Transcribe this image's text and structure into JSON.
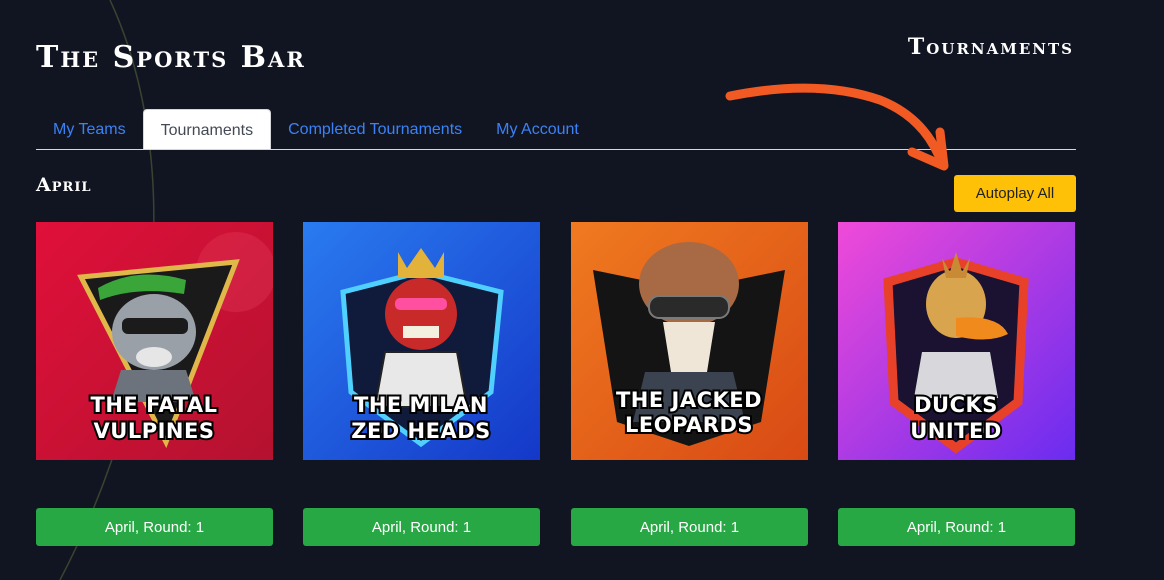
{
  "header": {
    "brand": "The Sports Bar",
    "page_title": "Tournaments"
  },
  "tabs": [
    {
      "label": "My Teams",
      "active": false
    },
    {
      "label": "Tournaments",
      "active": true
    },
    {
      "label": "Completed Tournaments",
      "active": false
    },
    {
      "label": "My Account",
      "active": false
    }
  ],
  "section": {
    "title": "April",
    "autoplay_label": "Autoplay All"
  },
  "teams": [
    {
      "line1": "THE FATAL",
      "line2": "VULPINES",
      "round_label": "April, Round: 1",
      "mascot": "raccoon-icon"
    },
    {
      "line1": "THE MILAN",
      "line2": "ZED HEADS",
      "round_label": "April, Round: 1",
      "mascot": "zombie-king-icon"
    },
    {
      "line1": "THE JACKED",
      "line2": "LEOPARDS",
      "round_label": "April, Round: 1",
      "mascot": "leopard-pilot-icon"
    },
    {
      "line1": "DUCKS",
      "line2": "UNITED",
      "round_label": "April, Round: 1",
      "mascot": "duck-icon"
    }
  ],
  "colors": {
    "background": "#111522",
    "tab_link": "#3b82f6",
    "autoplay": "#ffc107",
    "round_button": "#28a745",
    "arrow": "#f15a22"
  }
}
